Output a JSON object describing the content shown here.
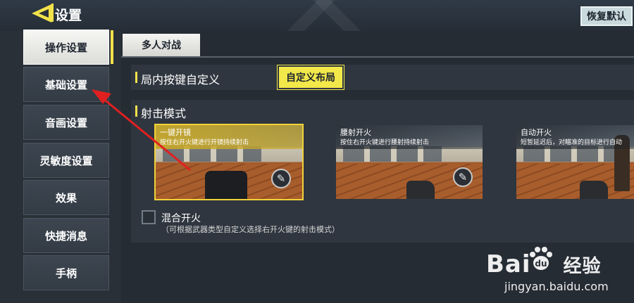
{
  "header": {
    "title": "设置",
    "reset_label": "恢复默认"
  },
  "sidebar": {
    "items": [
      {
        "label": "操作设置",
        "active": true
      },
      {
        "label": "基础设置",
        "active": false
      },
      {
        "label": "音画设置",
        "active": false
      },
      {
        "label": "灵敏度设置",
        "active": false
      },
      {
        "label": "效果",
        "active": false
      },
      {
        "label": "快捷消息",
        "active": false
      },
      {
        "label": "手柄",
        "active": false
      }
    ]
  },
  "tabs": [
    {
      "label": "多人对战",
      "active": true
    }
  ],
  "sections": {
    "button_custom": {
      "title": "局内按键自定义",
      "button_label": "自定义布局"
    },
    "fire_mode": {
      "title": "射击模式",
      "modes": [
        {
          "name": "一键开镜",
          "desc": "按住右开火键进行开镜持续射击",
          "selected": true,
          "icon": "rifle-icon"
        },
        {
          "name": "腰射开火",
          "desc": "按住右开火键进行腰射持续射击",
          "selected": false,
          "icon": "rifle-icon"
        },
        {
          "name": "自动开火",
          "desc": "短暂延迟后，对瞄准的目标进行自动",
          "selected": false,
          "icon": "none"
        }
      ],
      "mixed_fire": {
        "label": "混合开火",
        "note": "（可根据武器类型自定义选择右开火键的射击模式）",
        "checked": false
      }
    }
  },
  "watermark": {
    "logo": "Bai",
    "logo_suffix": "经验",
    "site": "jingyan.baidu.com"
  },
  "colors": {
    "accent": "#f2e24a",
    "annotation": "#e02020"
  }
}
